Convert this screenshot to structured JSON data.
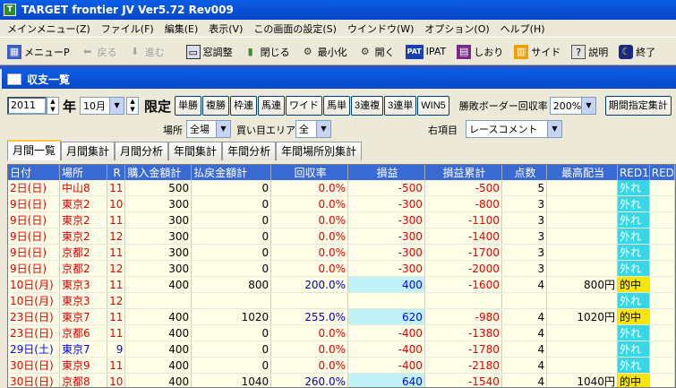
{
  "title": "TARGET frontier JV  Ver5.72  Rev009",
  "menu": [
    "メインメニュー(Z)",
    "ファイル(F)",
    "編集(E)",
    "表示(V)",
    "この画面の設定(S)",
    "ウインドウ(W)",
    "オプション(O)",
    "ヘルプ(H)"
  ],
  "toolbar": {
    "mainmenu": "メニューP",
    "back": "戻る",
    "forward": "進む",
    "window_adjust": "窓調整",
    "close": "閉じる",
    "minimize": "最小化",
    "open": "開く",
    "ipat": "IPAT",
    "bookmark": "しおり",
    "side": "サイド",
    "explain": "説明",
    "exit": "終了"
  },
  "window_title": "収支一覧",
  "filters": {
    "year": "2011",
    "year_label": "年",
    "month": "10月",
    "limit_label": "限定",
    "bet_buttons": [
      "単勝",
      "複勝",
      "枠連",
      "馬連",
      "ワイド",
      "馬単",
      "3連複",
      "3連単",
      "WIN5"
    ],
    "border_label": "勝敗ボーダー回収率",
    "border_value": "200%",
    "period_button": "期間指定集計",
    "place_label": "場所",
    "place_value": "全場",
    "area_label": "買い目エリア",
    "area_value": "全",
    "right_label": "右項目",
    "right_value": "レースコメント"
  },
  "tabs": [
    "月間一覧",
    "月間集計",
    "月間分析",
    "年間集計",
    "年間分析",
    "年間場所別集計"
  ],
  "table": {
    "headers": [
      "日付",
      "場所",
      "R",
      "購入金額計",
      "払戻金額計",
      "回収率",
      "損益",
      "損益累計",
      "点数",
      "最高配当",
      "RED1",
      "RED"
    ],
    "rows": [
      [
        "2日(日)",
        "中山8",
        "11",
        "500",
        "0",
        "0.0%",
        "-500",
        "-500",
        "5",
        "",
        "外れ",
        ""
      ],
      [
        "9日(日)",
        "東京2",
        "10",
        "300",
        "0",
        "0.0%",
        "-300",
        "-800",
        "3",
        "",
        "外れ",
        ""
      ],
      [
        "9日(日)",
        "東京2",
        "11",
        "300",
        "0",
        "0.0%",
        "-300",
        "-1100",
        "3",
        "",
        "外れ",
        ""
      ],
      [
        "9日(日)",
        "東京2",
        "12",
        "300",
        "0",
        "0.0%",
        "-300",
        "-1400",
        "3",
        "",
        "外れ",
        ""
      ],
      [
        "9日(日)",
        "京都2",
        "11",
        "300",
        "0",
        "0.0%",
        "-300",
        "-1700",
        "3",
        "",
        "外れ",
        ""
      ],
      [
        "9日(日)",
        "京都2",
        "12",
        "300",
        "0",
        "0.0%",
        "-300",
        "-2000",
        "3",
        "",
        "外れ",
        ""
      ],
      [
        "10日(月)",
        "東京3",
        "11",
        "400",
        "800",
        "200.0%",
        "400",
        "-1600",
        "4",
        "800円",
        "的中",
        ""
      ],
      [
        "10日(月)",
        "東京3",
        "12",
        "",
        "",
        "",
        "",
        "",
        "",
        "",
        "外れ",
        ""
      ],
      [
        "23日(日)",
        "東京7",
        "11",
        "400",
        "1020",
        "255.0%",
        "620",
        "-980",
        "4",
        "1020円",
        "的中",
        ""
      ],
      [
        "23日(日)",
        "京都6",
        "11",
        "400",
        "0",
        "0.0%",
        "-400",
        "-1380",
        "4",
        "",
        "外れ",
        ""
      ],
      [
        "29日(土)",
        "東京7",
        "9",
        "400",
        "0",
        "0.0%",
        "-400",
        "-1780",
        "4",
        "",
        "外れ",
        ""
      ],
      [
        "30日(日)",
        "東京9",
        "11",
        "400",
        "0",
        "0.0%",
        "-400",
        "-2180",
        "4",
        "",
        "外れ",
        ""
      ],
      [
        "30日(日)",
        "京都8",
        "10",
        "400",
        "1040",
        "260.0%",
        "640",
        "-1540",
        "4",
        "1040円",
        "的中",
        ""
      ]
    ]
  },
  "colors": {
    "titlebar": "#0a5ee6",
    "header_bg": "#3a6ad4",
    "row_bg": "#ffffe8",
    "profit_cell": "#bff3f7",
    "miss": "#39d6e6",
    "hit": "#f7e600",
    "negative": "#e00000",
    "saturday": "#0000ff"
  }
}
